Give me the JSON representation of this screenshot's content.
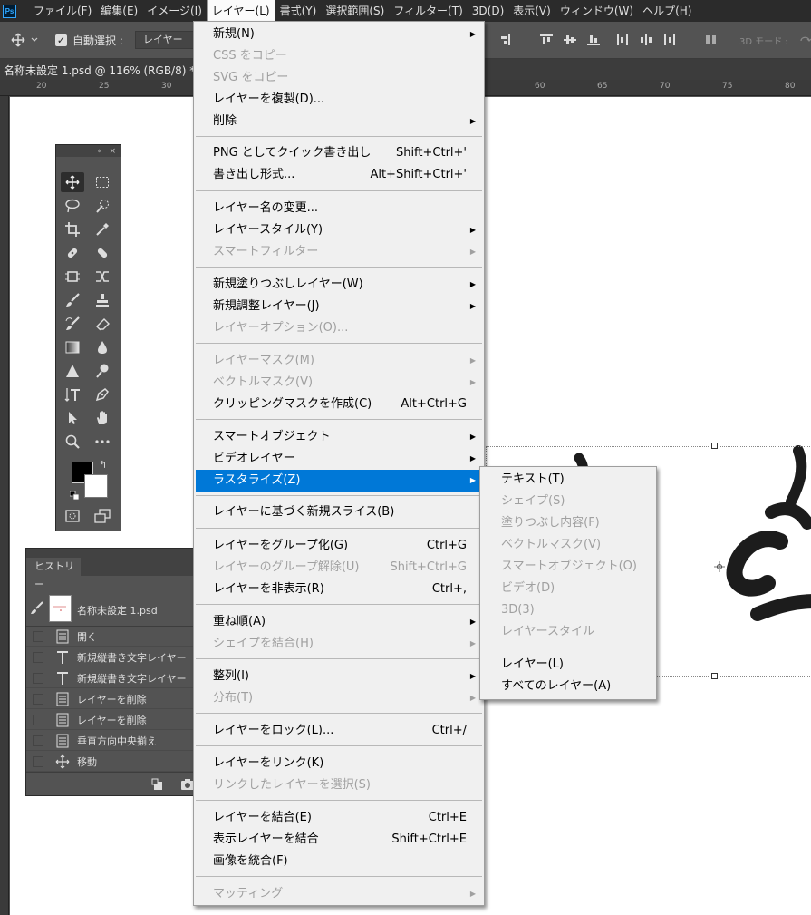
{
  "menubar": {
    "logo": "Ps",
    "items": [
      {
        "label": "ファイル(F)"
      },
      {
        "label": "編集(E)"
      },
      {
        "label": "イメージ(I)"
      },
      {
        "label": "レイヤー(L)"
      },
      {
        "label": "書式(Y)"
      },
      {
        "label": "選択範囲(S)"
      },
      {
        "label": "フィルター(T)"
      },
      {
        "label": "3D(D)"
      },
      {
        "label": "表示(V)"
      },
      {
        "label": "ウィンドウ(W)"
      },
      {
        "label": "ヘルプ(H)"
      }
    ]
  },
  "options": {
    "auto_select_label": "自動選択 :",
    "auto_select_target": "レイヤー",
    "mode_3d_label": "3D モード :"
  },
  "document": {
    "title": "名称未設定 1.psd @ 116% (RGB/8) *"
  },
  "ruler": {
    "numbers": [
      "20",
      "25",
      "30",
      "60",
      "65",
      "70",
      "75",
      "80"
    ]
  },
  "tools_panel": {
    "collapse_glyph": "«",
    "close_glyph": "×"
  },
  "history": {
    "tab_label": "ヒストリー",
    "snapshot_label": "名称未設定 1.psd",
    "steps": [
      {
        "icon": "doc",
        "label": "開く"
      },
      {
        "icon": "T",
        "label": "新規縦書き文字レイヤー"
      },
      {
        "icon": "T",
        "label": "新規縦書き文字レイヤー"
      },
      {
        "icon": "doc",
        "label": "レイヤーを削除"
      },
      {
        "icon": "doc",
        "label": "レイヤーを削除"
      },
      {
        "icon": "doc",
        "label": "垂直方向中央揃え"
      },
      {
        "icon": "move",
        "label": "移動"
      }
    ]
  },
  "layer_menu": {
    "items": [
      {
        "label": "新規(N)",
        "shortcut": "",
        "submenu": true,
        "disabled": false
      },
      {
        "label": "CSS をコピー",
        "shortcut": "",
        "submenu": false,
        "disabled": true
      },
      {
        "label": "SVG をコピー",
        "shortcut": "",
        "submenu": false,
        "disabled": true
      },
      {
        "label": "レイヤーを複製(D)...",
        "shortcut": "",
        "submenu": false,
        "disabled": false
      },
      {
        "label": "削除",
        "shortcut": "",
        "submenu": true,
        "disabled": false
      },
      {
        "label": "PNG としてクイック書き出し",
        "shortcut": "Shift+Ctrl+'",
        "submenu": false,
        "disabled": false
      },
      {
        "label": "書き出し形式...",
        "shortcut": "Alt+Shift+Ctrl+'",
        "submenu": false,
        "disabled": false
      },
      {
        "label": "レイヤー名の変更...",
        "shortcut": "",
        "submenu": false,
        "disabled": false
      },
      {
        "label": "レイヤースタイル(Y)",
        "shortcut": "",
        "submenu": true,
        "disabled": false
      },
      {
        "label": "スマートフィルター",
        "shortcut": "",
        "submenu": true,
        "disabled": true
      },
      {
        "label": "新規塗りつぶしレイヤー(W)",
        "shortcut": "",
        "submenu": true,
        "disabled": false
      },
      {
        "label": "新規調整レイヤー(J)",
        "shortcut": "",
        "submenu": true,
        "disabled": false
      },
      {
        "label": "レイヤーオプション(O)...",
        "shortcut": "",
        "submenu": false,
        "disabled": true
      },
      {
        "label": "レイヤーマスク(M)",
        "shortcut": "",
        "submenu": true,
        "disabled": true
      },
      {
        "label": "ベクトルマスク(V)",
        "shortcut": "",
        "submenu": true,
        "disabled": true
      },
      {
        "label": "クリッピングマスクを作成(C)",
        "shortcut": "Alt+Ctrl+G",
        "submenu": false,
        "disabled": false
      },
      {
        "label": "スマートオブジェクト",
        "shortcut": "",
        "submenu": true,
        "disabled": false
      },
      {
        "label": "ビデオレイヤー",
        "shortcut": "",
        "submenu": true,
        "disabled": false
      },
      {
        "label": "ラスタライズ(Z)",
        "shortcut": "",
        "submenu": true,
        "disabled": false,
        "highlighted": true
      },
      {
        "label": "レイヤーに基づく新規スライス(B)",
        "shortcut": "",
        "submenu": false,
        "disabled": false
      },
      {
        "label": "レイヤーをグループ化(G)",
        "shortcut": "Ctrl+G",
        "submenu": false,
        "disabled": false
      },
      {
        "label": "レイヤーのグループ解除(U)",
        "shortcut": "Shift+Ctrl+G",
        "submenu": false,
        "disabled": true
      },
      {
        "label": "レイヤーを非表示(R)",
        "shortcut": "Ctrl+,",
        "submenu": false,
        "disabled": false
      },
      {
        "label": "重ね順(A)",
        "shortcut": "",
        "submenu": true,
        "disabled": false
      },
      {
        "label": "シェイプを結合(H)",
        "shortcut": "",
        "submenu": true,
        "disabled": true
      },
      {
        "label": "整列(I)",
        "shortcut": "",
        "submenu": true,
        "disabled": false
      },
      {
        "label": "分布(T)",
        "shortcut": "",
        "submenu": true,
        "disabled": true
      },
      {
        "label": "レイヤーをロック(L)...",
        "shortcut": "Ctrl+/",
        "submenu": false,
        "disabled": false
      },
      {
        "label": "レイヤーをリンク(K)",
        "shortcut": "",
        "submenu": false,
        "disabled": false
      },
      {
        "label": "リンクしたレイヤーを選択(S)",
        "shortcut": "",
        "submenu": false,
        "disabled": true
      },
      {
        "label": "レイヤーを結合(E)",
        "shortcut": "Ctrl+E",
        "submenu": false,
        "disabled": false
      },
      {
        "label": "表示レイヤーを結合",
        "shortcut": "Shift+Ctrl+E",
        "submenu": false,
        "disabled": false
      },
      {
        "label": "画像を統合(F)",
        "shortcut": "",
        "submenu": false,
        "disabled": false
      },
      {
        "label": "マッティング",
        "shortcut": "",
        "submenu": true,
        "disabled": true
      }
    ]
  },
  "rasterize_menu": {
    "items": [
      {
        "label": "テキスト(T)",
        "disabled": false
      },
      {
        "label": "シェイプ(S)",
        "disabled": true
      },
      {
        "label": "塗りつぶし内容(F)",
        "disabled": true
      },
      {
        "label": "ベクトルマスク(V)",
        "disabled": true
      },
      {
        "label": "スマートオブジェクト(O)",
        "disabled": true
      },
      {
        "label": "ビデオ(D)",
        "disabled": true
      },
      {
        "label": "3D(3)",
        "disabled": true
      },
      {
        "label": "レイヤースタイル",
        "disabled": true
      },
      {
        "label": "レイヤー(L)",
        "disabled": false
      },
      {
        "label": "すべてのレイヤー(A)",
        "disabled": false
      }
    ]
  },
  "colors": {
    "menu_highlight": "#0078d7",
    "foreground": "#000000",
    "background": "#ffffff"
  }
}
